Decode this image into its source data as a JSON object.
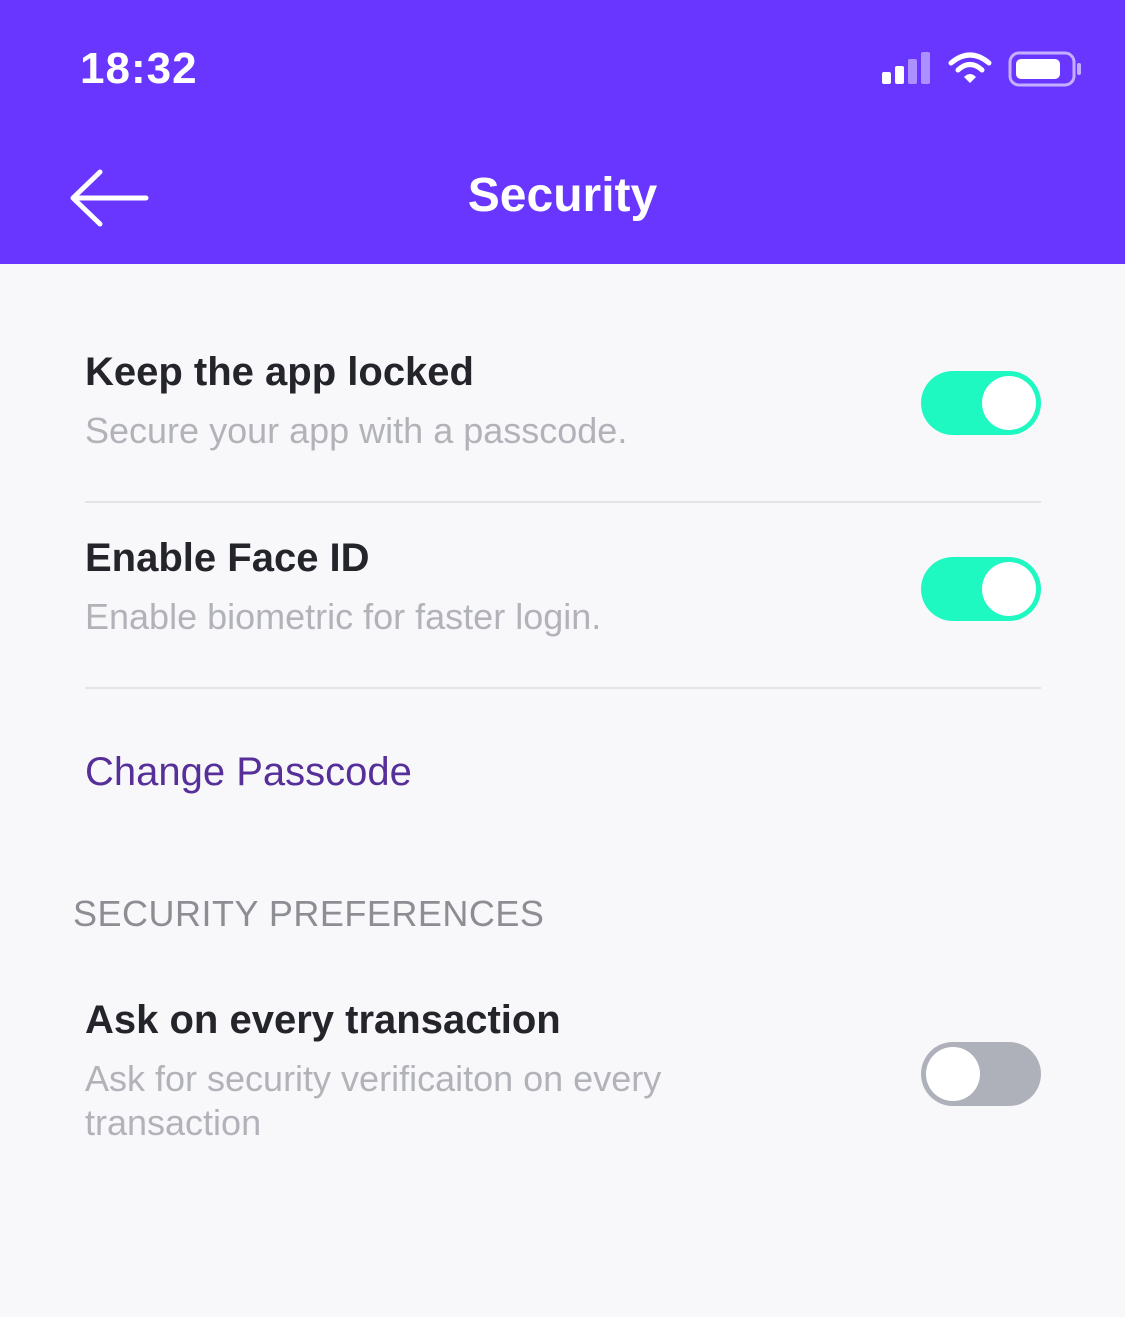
{
  "status_bar": {
    "time": "18:32"
  },
  "header": {
    "title": "Security",
    "back_icon": "arrow-left-icon",
    "background": "#6936ff"
  },
  "settings": [
    {
      "title": "Keep the app locked",
      "description": "Secure your app with a passcode.",
      "enabled": true
    },
    {
      "title": "Enable Face ID",
      "description": "Enable biometric for faster login.",
      "enabled": true
    }
  ],
  "change_passcode_label": "Change Passcode",
  "preferences": {
    "section_title": "SECURITY PREFERENCES",
    "items": [
      {
        "title": "Ask on every transaction",
        "description": "Ask for security verificaiton on every transaction",
        "enabled": false
      }
    ]
  },
  "colors": {
    "toggle_on": "#1ef8c1",
    "toggle_off": "#aeb1ba",
    "link": "#563098"
  }
}
